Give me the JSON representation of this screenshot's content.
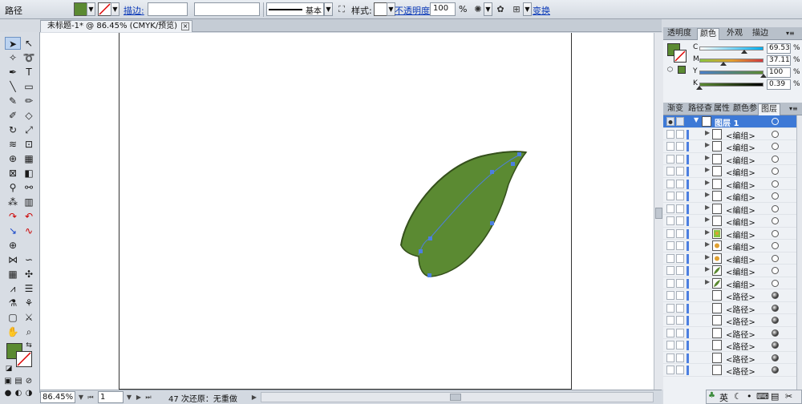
{
  "control_bar": {
    "object_type": "路径",
    "fill_color": "#5b8a32",
    "stroke_label": "描边:",
    "stroke_weight": "",
    "brush_value": "",
    "stroke_profile": "基本",
    "style_label": "样式:",
    "opacity_label": "不透明度:",
    "opacity_value": "100",
    "opacity_unit": "%",
    "transform_label": "变换"
  },
  "document_tab": {
    "title": "未标题-1* @ 86.45% (CMYK/预览)",
    "close": "×"
  },
  "toolbar": {
    "fill_color": "#5b8a32",
    "stroke_color": "#ffffff"
  },
  "canvas": {
    "leaf_color": "#5b8a32",
    "leaf_edge": "#35501c",
    "anchor_color": "#4c7fe0"
  },
  "status_bar": {
    "zoom": "86.45%",
    "page": "1",
    "message": "47 次还原：无重做"
  },
  "color_panel": {
    "tabs": [
      "透明度",
      "颜色",
      "外观",
      "描边"
    ],
    "active_tab": "颜色",
    "sliders": [
      {
        "label": "C",
        "value": "69.53",
        "unit": "%",
        "level": 0.6953
      },
      {
        "label": "M",
        "value": "37.11",
        "unit": "%",
        "level": 0.3711
      },
      {
        "label": "Y",
        "value": "100",
        "unit": "%",
        "level": 1.0
      },
      {
        "label": "K",
        "value": "0.39",
        "unit": "%",
        "level": 0.0039
      }
    ]
  },
  "layers_panel": {
    "tabs": [
      "渐变",
      "路径查",
      "属性",
      "颜色参",
      "图层"
    ],
    "active_tab": "图层",
    "top_layer": "图层 1",
    "items": [
      {
        "name": "<编组>",
        "thumb": "blank",
        "filled": false
      },
      {
        "name": "<编组>",
        "thumb": "blank",
        "filled": false
      },
      {
        "name": "<编组>",
        "thumb": "blank",
        "filled": false
      },
      {
        "name": "<编组>",
        "thumb": "blank",
        "filled": false
      },
      {
        "name": "<编组>",
        "thumb": "blank",
        "filled": false
      },
      {
        "name": "<编组>",
        "thumb": "blank",
        "filled": false
      },
      {
        "name": "<编组>",
        "thumb": "blank",
        "filled": false
      },
      {
        "name": "<编组>",
        "thumb": "blank",
        "filled": false
      },
      {
        "name": "<编组>",
        "thumb": "art",
        "filled": false
      },
      {
        "name": "<编组>",
        "thumb": "dot",
        "filled": false
      },
      {
        "name": "<编组>",
        "thumb": "dot",
        "filled": false
      },
      {
        "name": "<编组>",
        "thumb": "leaf",
        "filled": false
      },
      {
        "name": "<编组>",
        "thumb": "leaf",
        "filled": false
      },
      {
        "name": "<路径>",
        "thumb": "blank",
        "filled": true
      },
      {
        "name": "<路径>",
        "thumb": "blank",
        "filled": true
      },
      {
        "name": "<路径>",
        "thumb": "blank",
        "filled": true
      },
      {
        "name": "<路径>",
        "thumb": "blank",
        "filled": true
      },
      {
        "name": "<路径>",
        "thumb": "blank",
        "filled": true
      },
      {
        "name": "<路径>",
        "thumb": "blank",
        "filled": true
      },
      {
        "name": "<路径>",
        "thumb": "blank",
        "filled": true
      }
    ]
  },
  "ime": {
    "lang": "英",
    "icons": [
      "moon-icon",
      "dot-icon",
      "keyboard-icon",
      "menu-icon",
      "wrench-icon"
    ]
  }
}
